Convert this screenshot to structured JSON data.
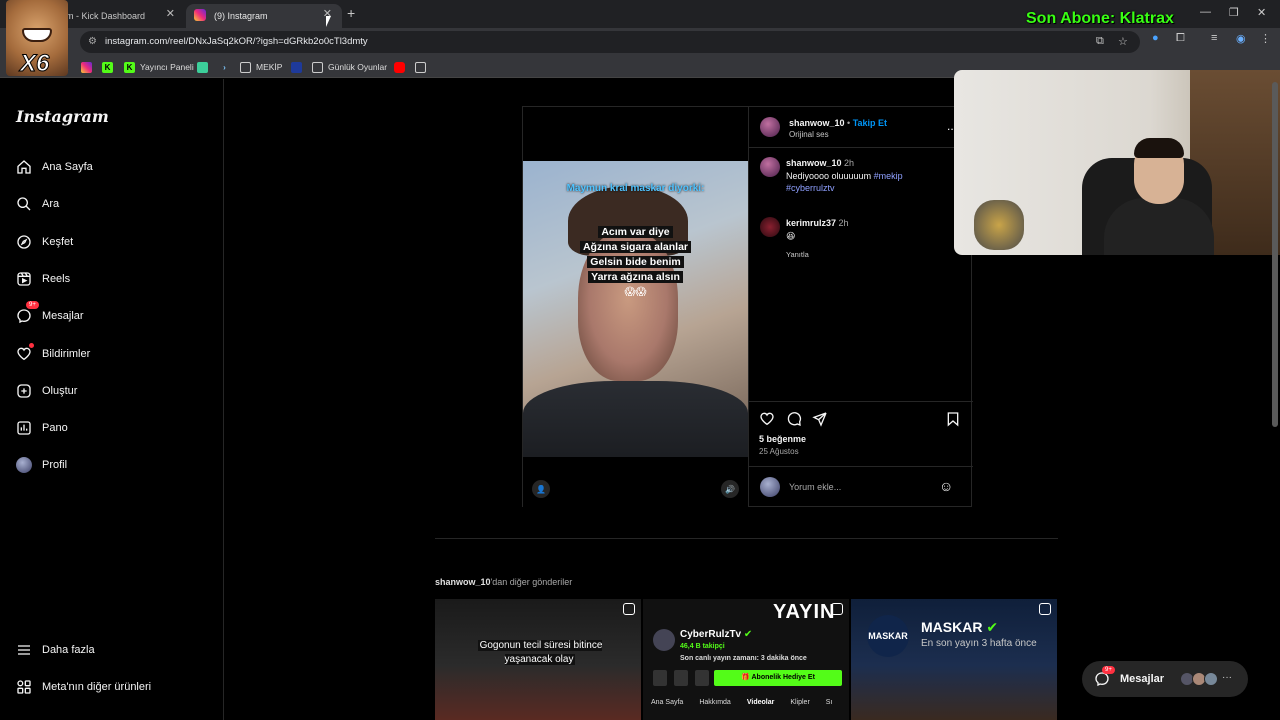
{
  "browser": {
    "tabs": [
      {
        "label": "m - Kick Dashboard"
      },
      {
        "label": "(9) Instagram"
      }
    ],
    "url": "instagram.com/reel/DNxJaSq2kOR/?igsh=dGRkb2o0cTl3dmty",
    "bookmarks": [
      {
        "label": "Yayıncı Paneli"
      },
      {
        "label": "MEKİP"
      },
      {
        "label": "Günlük Oyunlar"
      }
    ]
  },
  "overlay": {
    "subscriber_text": "Son Abone: Klatrax",
    "emote_text": "X6"
  },
  "sidebar": {
    "logo": "Instagram",
    "items": [
      {
        "label": "Ana Sayfa",
        "icon": "home-icon"
      },
      {
        "label": "Ara",
        "icon": "search-icon"
      },
      {
        "label": "Keşfet",
        "icon": "compass-icon"
      },
      {
        "label": "Reels",
        "icon": "reels-icon"
      },
      {
        "label": "Mesajlar",
        "icon": "messenger-icon",
        "badge": "9+"
      },
      {
        "label": "Bildirimler",
        "icon": "heart-icon"
      },
      {
        "label": "Oluştur",
        "icon": "plus-square-icon"
      },
      {
        "label": "Pano",
        "icon": "chart-icon"
      },
      {
        "label": "Profil",
        "icon": "avatar"
      }
    ],
    "more": "Daha fazla",
    "meta": "Meta'nın diğer ürünleri"
  },
  "post": {
    "video": {
      "top_caption": "Maymun kral maskar diyorki:",
      "lines": [
        "Acım var diye",
        "Ağzına sigara alanlar",
        "Gelsin bide benim",
        "Yarra ağzına alsın",
        "😱😱"
      ]
    },
    "header": {
      "username": "shanwow_10",
      "follow": "Takip Et",
      "audio": "Orijinal ses",
      "more": "..."
    },
    "caption": {
      "username": "shanwow_10",
      "time": "2h",
      "text": "Nediyoooo oluuuuum",
      "tag1": "#mekip",
      "tag2": "#cyberrulztv"
    },
    "comment": {
      "username": "kerimrulz37",
      "time": "2h",
      "text": "😆",
      "reply": "Yanıtla"
    },
    "likes": "5 beğenme",
    "date": "25 Ağustos",
    "comment_placeholder": "Yorum ekle..."
  },
  "more_posts": {
    "owner": "shanwow_10",
    "suffix": "'dan diğer gönderiler",
    "thumb1_caption": "Gogonun tecil süresi bitince yaşanacak olay",
    "thumb2": {
      "banner": "YAYIN",
      "name": "CyberRulzTv",
      "followers": "46,4 B takipçi",
      "last_live": "Son canlı yayın zamanı: 3 dakika önce",
      "gift_button": "🎁 Abonelik Hediye Et",
      "tabs": [
        "Ana Sayfa",
        "Hakkımda",
        "Videolar",
        "Klipler",
        "Sı"
      ]
    },
    "thumb3": {
      "logo": "MASKAR",
      "name": "MASKAR",
      "sub": "En son yayın 3 hafta önce"
    }
  },
  "messages_pill": {
    "label": "Mesajlar",
    "badge": "9+",
    "more": "···"
  }
}
